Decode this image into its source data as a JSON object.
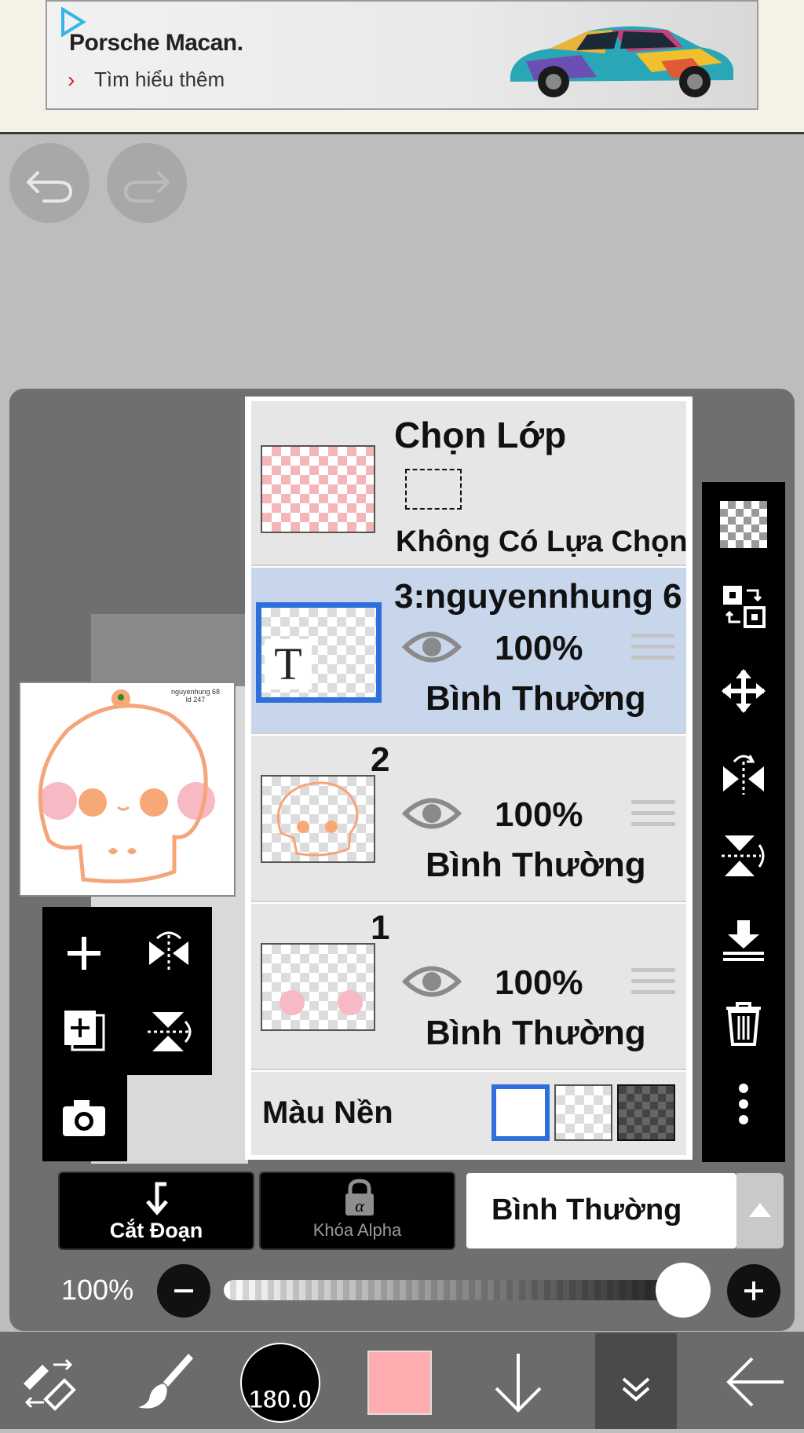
{
  "ad": {
    "title": "Porsche Macan.",
    "cta": "Tìm hiểu thêm",
    "cta_color": "#d2232a"
  },
  "top_controls": {
    "undo_icon": "undo-icon",
    "redo_icon": "redo-icon"
  },
  "preview": {
    "watermark_line1": "nguyenhung 68",
    "watermark_line2": "ld 247"
  },
  "layers_panel": {
    "selection": {
      "title": "Chọn Lớp",
      "status": "Không Có Lựa Chọn"
    },
    "layers": [
      {
        "name": "3:nguyennhung 6",
        "opacity": "100%",
        "blend": "Bình Thường",
        "selected": true,
        "type_icon": "T"
      },
      {
        "name": "2",
        "opacity": "100%",
        "blend": "Bình Thường",
        "selected": false
      },
      {
        "name": "1",
        "opacity": "100%",
        "blend": "Bình Thường",
        "selected": false
      }
    ],
    "background": {
      "label": "Màu Nền",
      "options": [
        "white",
        "transparent",
        "dark"
      ],
      "selected": "white"
    }
  },
  "bottom_bar": {
    "clip_label": "Cắt Đoạn",
    "alpha_lock_label": "Khóa Alpha",
    "blend_mode": "Bình Thường",
    "opacity_label": "100%",
    "opacity_value": 1.0
  },
  "main_toolbar": {
    "brush_size": "180.0",
    "current_color": "#ffadb0",
    "accent_color": "#2f6fdc"
  }
}
